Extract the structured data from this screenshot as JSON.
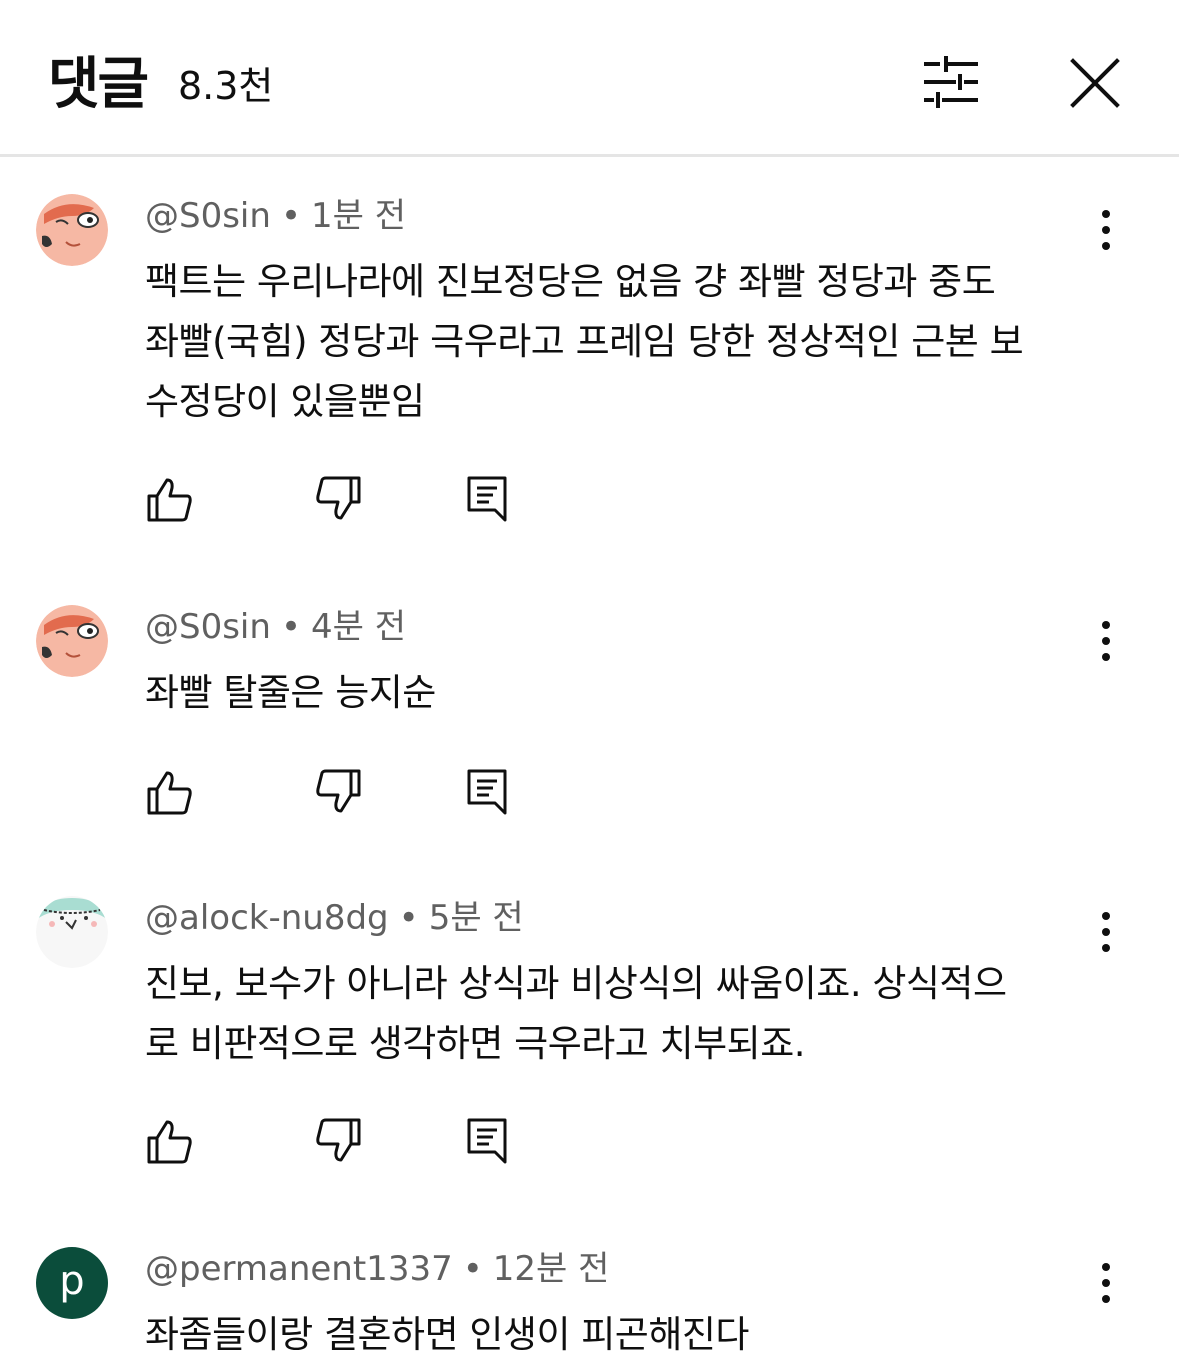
{
  "header": {
    "title": "댓글",
    "count": "8.3천"
  },
  "comments": [
    {
      "author": "@S0sin",
      "time": "1분 전",
      "text_lines": [
        "팩트는 우리나라에 진보정당은 없음 걍 좌빨 정당과 중도",
        "좌빨(국힘) 정당과 극우라고 프레임 당한 정상적인 근본 보",
        "수정당이 있을뿐임"
      ],
      "avatar_icon": "cartoon-face-avatar"
    },
    {
      "author": "@S0sin",
      "time": "4분 전",
      "text_lines": [
        "좌빨 탈줄은 능지순"
      ],
      "avatar_icon": "cartoon-face-avatar"
    },
    {
      "author": "@alock-nu8dg",
      "time": "5분 전",
      "text_lines": [
        "진보, 보수가 아니라 상식과 비상식의 싸움이죠. 상식적으",
        "로 비판적으로 생각하면 극우라고 치부되죠."
      ],
      "avatar_icon": "mint-hair-face-avatar"
    },
    {
      "author": "@permanent1337",
      "time": "12분 전",
      "text_lines": [
        "좌좀들이랑 결혼하면 인생이 피곤해진다"
      ],
      "avatar_letter": "p",
      "avatar_color": "#0b4d3b"
    }
  ],
  "meta_separator": "•",
  "icons": {
    "filter": "sliders-icon",
    "close": "close-icon",
    "more": "more-vertical-icon",
    "like": "thumbs-up-icon",
    "dislike": "thumbs-down-icon",
    "reply": "reply-comment-icon"
  },
  "colors": {
    "text_primary": "#0f0f0f",
    "text_secondary": "#606060",
    "divider": "#e5e5e5",
    "avatar_face": "#f6b8a4",
    "avatar_accent": "#e26b4e",
    "avatar_mint": "#a9ddd2"
  }
}
